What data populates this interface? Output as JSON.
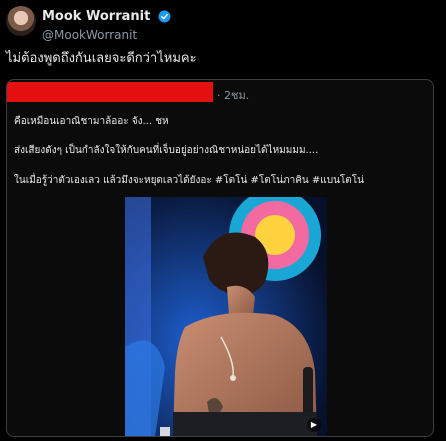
{
  "author": {
    "display_name": "Mook Worranit",
    "handle": "@MookWorranit",
    "verified_color": "#1d9bf0"
  },
  "tweet": {
    "text": "ไม่ต้องพูดถึงกันเลยจะดีกว่าไหมคะ"
  },
  "quoted": {
    "time": "· 2ชม.",
    "lines": [
      "คือเหมือนเอาณิชามาล้ออะ จัง... ชห",
      "ส่งเสียงดังๆ เป็นกำลังใจให้กับคนที่เจ็บอยู่อย่างณิชาหน่อยได้ไหมมมม....",
      "ในเมื่อรู้ว่าตัวเองเลว แล้วมึงจะหยุดเลวได้ยังอะ #โตโน่ #โตโน่ภาคิน #แบนโตโน่"
    ]
  },
  "media": {
    "play_icon": "▶"
  }
}
